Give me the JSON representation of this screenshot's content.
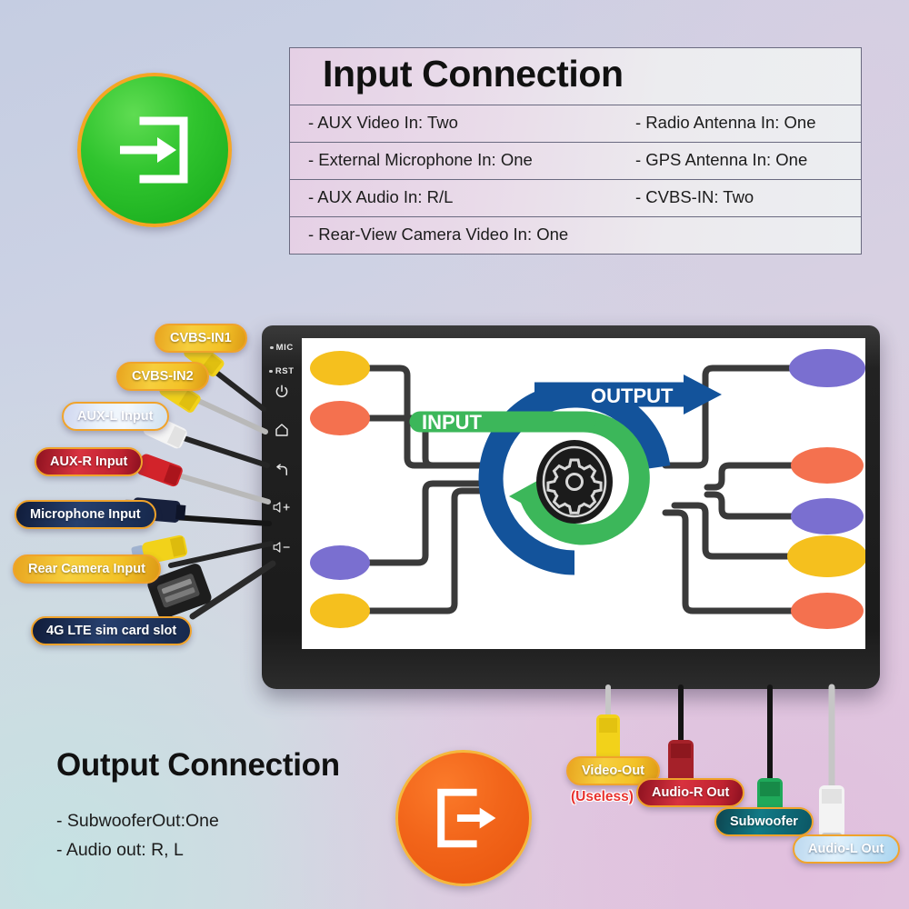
{
  "input_section": {
    "title": "Input Connection",
    "badge_icon": "input-arrow-icon",
    "badge_color": "#2dbb2c",
    "rows": [
      {
        "left": "- AUX Video In: Two",
        "right": "- Radio Antenna In: One"
      },
      {
        "left": "- External Microphone In: One",
        "right": "- GPS Antenna In: One"
      },
      {
        "left": "- AUX Audio In: R/L",
        "right": "- CVBS-IN: Two"
      },
      {
        "left": "- Rear-View Camera Video In: One",
        "right": ""
      }
    ]
  },
  "output_section": {
    "title": "Output Connection",
    "badge_icon": "output-arrow-icon",
    "badge_color": "#f2651a",
    "items": [
      "- SubwooferOut:One",
      "- Audio out: R, L"
    ]
  },
  "input_labels": [
    {
      "text": "CVBS-IN1",
      "style": "gold"
    },
    {
      "text": "CVBS-IN2",
      "style": "gold"
    },
    {
      "text": "AUX-L Input",
      "style": "ice"
    },
    {
      "text": "AUX-R Input",
      "style": "red"
    },
    {
      "text": "Microphone Input",
      "style": "navy"
    },
    {
      "text": "Rear Camera Input",
      "style": "gold"
    },
    {
      "text": "4G LTE sim card slot",
      "style": "navy"
    }
  ],
  "output_labels": [
    {
      "text": "Video-Out",
      "style": "gold"
    },
    {
      "text": "Audio-R Out",
      "style": "red"
    },
    {
      "text": "Subwoofer",
      "style": "teal"
    },
    {
      "text": "Audio-L Out",
      "style": "iceblue"
    }
  ],
  "output_note": "(Useless)",
  "head_unit": {
    "buttons": [
      {
        "name": "mic",
        "label": "MIC"
      },
      {
        "name": "reset",
        "label": "RST"
      },
      {
        "name": "power",
        "label": ""
      },
      {
        "name": "home",
        "label": ""
      },
      {
        "name": "back",
        "label": ""
      },
      {
        "name": "volume-up",
        "label": ""
      },
      {
        "name": "volume-down",
        "label": ""
      }
    ]
  },
  "flow_diagram": {
    "input_label": "INPUT",
    "output_label": "OUTPUT",
    "input_color": "#3cb75a",
    "output_color": "#13539b",
    "center_icon": "gear-icon",
    "left_nodes": [
      "#f5c01e",
      "#f4714f",
      "#7a6fd0",
      "#f5c01e"
    ],
    "right_nodes": [
      "#7a6fd0",
      "#f4714f",
      "#7a6fd0",
      "#f5c01e",
      "#f4714f"
    ]
  }
}
